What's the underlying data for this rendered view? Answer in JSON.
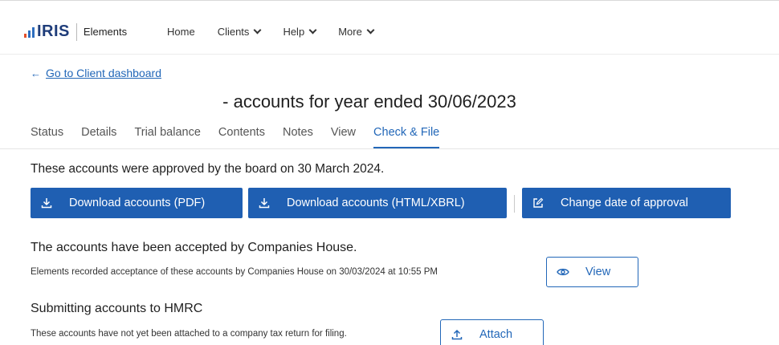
{
  "header": {
    "logo_text": "IRIS",
    "product": "Elements",
    "nav": [
      {
        "label": "Home"
      },
      {
        "label": "Clients"
      },
      {
        "label": "Help"
      },
      {
        "label": "More"
      }
    ]
  },
  "back_link": {
    "arrow": "←",
    "label": "Go to Client dashboard"
  },
  "page_title": "- accounts for year ended 30/06/2023",
  "tabs": [
    {
      "label": "Status"
    },
    {
      "label": "Details"
    },
    {
      "label": "Trial balance"
    },
    {
      "label": "Contents"
    },
    {
      "label": "Notes"
    },
    {
      "label": "View"
    },
    {
      "label": "Check & File"
    }
  ],
  "approval": {
    "text": "These accounts were approved by the board on 30 March 2024.",
    "buttons": {
      "download_pdf": "Download accounts (PDF)",
      "download_html": "Download accounts (HTML/XBRL)",
      "change_date": "Change date of approval"
    }
  },
  "companies_house": {
    "heading": "The accounts have been accepted by Companies House.",
    "text": "Elements recorded acceptance of these accounts by Companies House on 30/03/2024 at 10:55 PM",
    "view_button": "View"
  },
  "hmrc": {
    "heading": "Submitting accounts to HMRC",
    "text": "These accounts have not yet been attached to a company tax return for filing.",
    "attach_button": "Attach"
  },
  "colors": {
    "primary": "#1f5fb2",
    "link": "#2267b8",
    "logo_orange": "#e4502b",
    "logo_blue": "#2c6dbf"
  }
}
